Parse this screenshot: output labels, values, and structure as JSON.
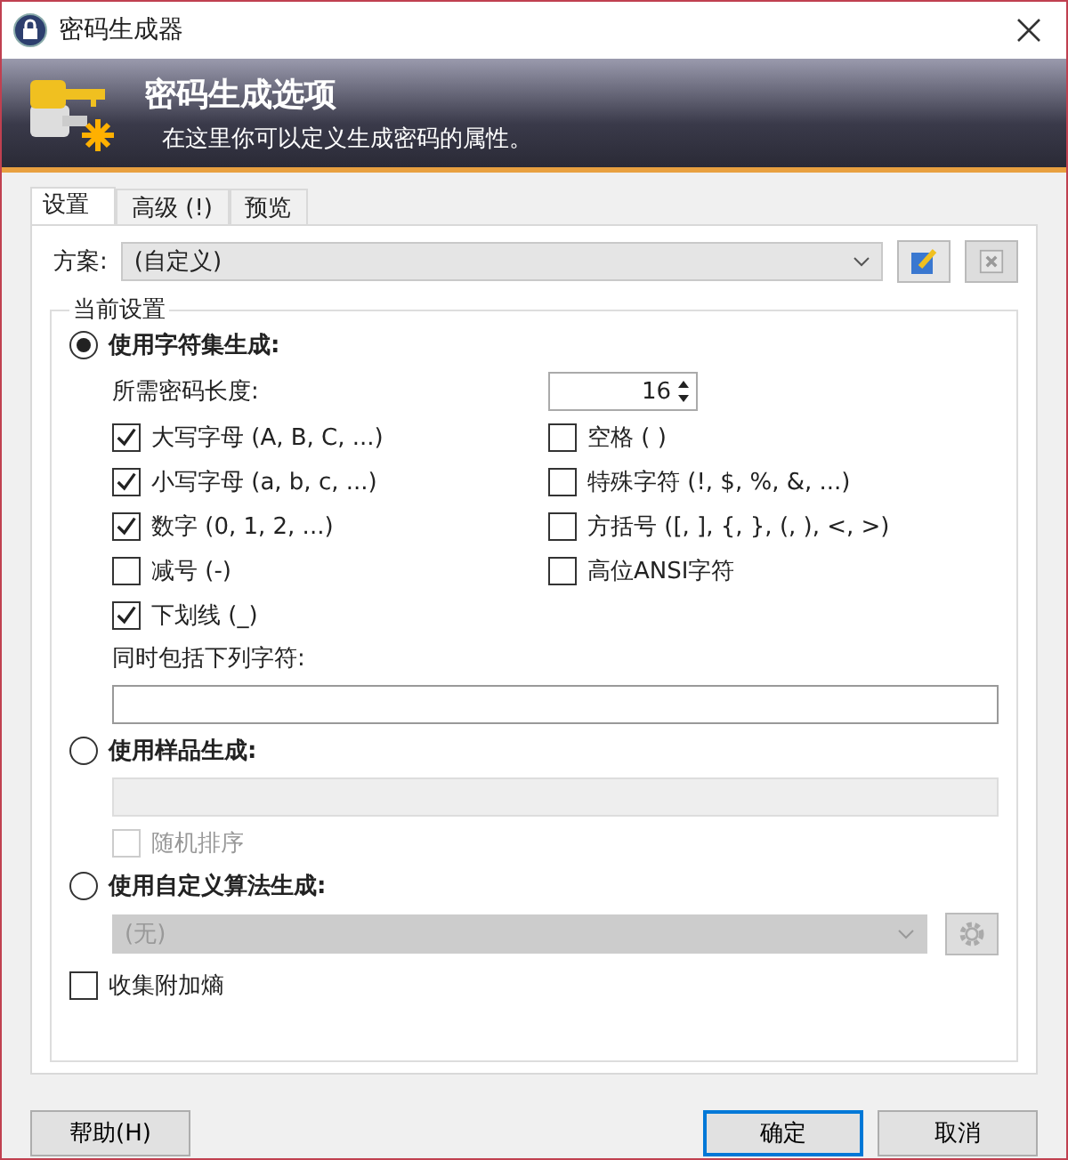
{
  "window": {
    "title": "密码生成器"
  },
  "header": {
    "title": "密码生成选项",
    "subtitle": "在这里你可以定义生成密码的属性。"
  },
  "tabs": [
    {
      "label": "设置",
      "selected": true
    },
    {
      "label": "高级 (!)",
      "selected": false
    },
    {
      "label": "预览",
      "selected": false
    }
  ],
  "profile": {
    "label": "方案:",
    "value": "(自定义)"
  },
  "group": {
    "title": "当前设置",
    "charset_mode": {
      "label": "使用字符集生成:",
      "selected": true
    },
    "length": {
      "label": "所需密码长度:",
      "value": "16"
    },
    "charsets": [
      {
        "label": "大写字母 (A, B, C, ...)",
        "checked": true
      },
      {
        "label": "空格 ( )",
        "checked": false
      },
      {
        "label": "小写字母 (a, b, c, ...)",
        "checked": true
      },
      {
        "label": "特殊字符 (!, $, %, &, ...)",
        "checked": false
      },
      {
        "label": "数字 (0, 1, 2, ...)",
        "checked": true
      },
      {
        "label": "方括号 ([, ], {, }, (, ), <, >)",
        "checked": false
      },
      {
        "label": "减号 (-)",
        "checked": false
      },
      {
        "label": "高位ANSI字符",
        "checked": false
      },
      {
        "label": "下划线 (_)",
        "checked": true
      }
    ],
    "include_label": "同时包括下列字符:",
    "pattern_mode": {
      "label": "使用样品生成:",
      "selected": false
    },
    "shuffle": {
      "label": "随机排序",
      "checked": false,
      "disabled": true
    },
    "custom_mode": {
      "label": "使用自定义算法生成:",
      "selected": false
    },
    "algorithm": {
      "value": "(无)",
      "disabled": true
    },
    "entropy": {
      "label": "收集附加熵",
      "checked": false
    }
  },
  "buttons": {
    "help": "帮助(H)",
    "ok": "确定",
    "cancel": "取消"
  }
}
